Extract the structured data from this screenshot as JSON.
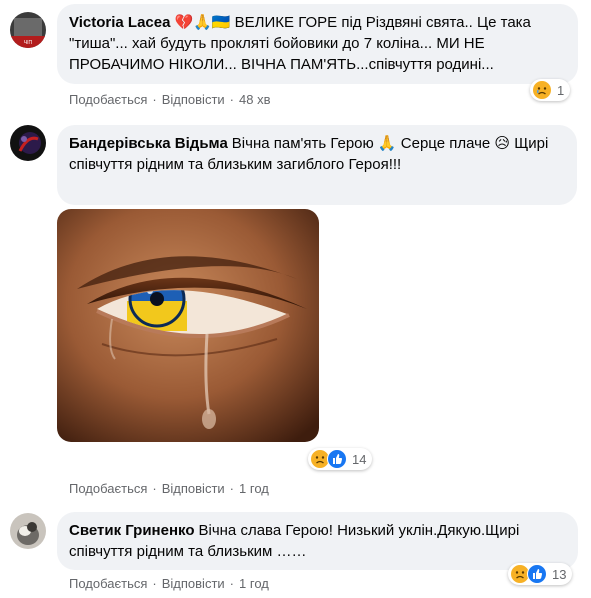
{
  "comments": [
    {
      "author": "Victoria Lacea",
      "text": "💔🙏🇺🇦 ВЕЛИКЕ ГОРЕ під Різдвяні свята.. Це така \"тиша\"... хай будуть прокляті бойовики до 7 коліна... МИ НЕ ПРОБАЧИМО НІКОЛИ... ВІЧНА ПАМ'ЯТЬ...співчуття родині...",
      "like_label": "Подобається",
      "reply_label": "Відповісти",
      "time": "48 хв",
      "reaction_count": "1",
      "reactions": [
        "sad"
      ]
    },
    {
      "author": "Бандерівська Відьма",
      "text": "Вічна пам'ять Герою 🙏 Серце плаче 😥 Щирі співчуття рідним та близьким загиблого Героя!!!",
      "like_label": "Подобається",
      "reply_label": "Відповісти",
      "time": "1 год",
      "reaction_count": "14",
      "reactions": [
        "sad",
        "like"
      ],
      "image": "crying-eye-ukraine-flag"
    },
    {
      "author": "Светик Гриненко",
      "text": "Вічна слава Герою!  Низький уклін.Дякую.Щирі співчуття рідним та близьким ……",
      "like_label": "Подобається",
      "reply_label": "Відповісти",
      "time": "1 год",
      "reaction_count": "13",
      "reactions": [
        "sad",
        "like"
      ]
    }
  ],
  "colors": {
    "bubble": "#f0f2f5",
    "meta": "#65676b",
    "like": "#1877f2",
    "sad": "#f7b125"
  }
}
